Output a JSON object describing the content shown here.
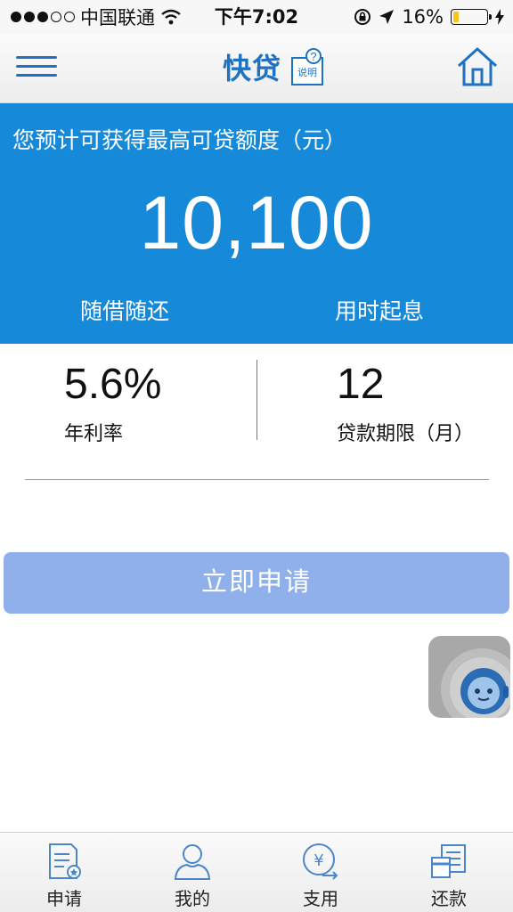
{
  "status_bar": {
    "carrier": "中国联通",
    "time": "下午7:02",
    "battery": "16%",
    "battery_level": 0.16
  },
  "nav": {
    "title": "快贷",
    "help_label": "说明",
    "help_mark": "?"
  },
  "hero": {
    "caption": "您预计可获得最高可贷额度（元）",
    "amount": "10,100",
    "feature_left": "随借随还",
    "feature_right": "用时起息"
  },
  "stats": {
    "rate_value": "5.6%",
    "rate_label": "年利率",
    "term_value": "12",
    "term_label": "贷款期限（月）"
  },
  "apply_button": "立即申请",
  "tabs": [
    {
      "label": "申请",
      "icon": "apply-document-icon"
    },
    {
      "label": "我的",
      "icon": "user-icon"
    },
    {
      "label": "支用",
      "icon": "yuan-transfer-icon"
    },
    {
      "label": "还款",
      "icon": "repay-cards-icon"
    }
  ],
  "colors": {
    "primary": "#168ad9",
    "accent": "#1e72c4",
    "button": "#8fb0ea",
    "battery": "#f5c518"
  }
}
